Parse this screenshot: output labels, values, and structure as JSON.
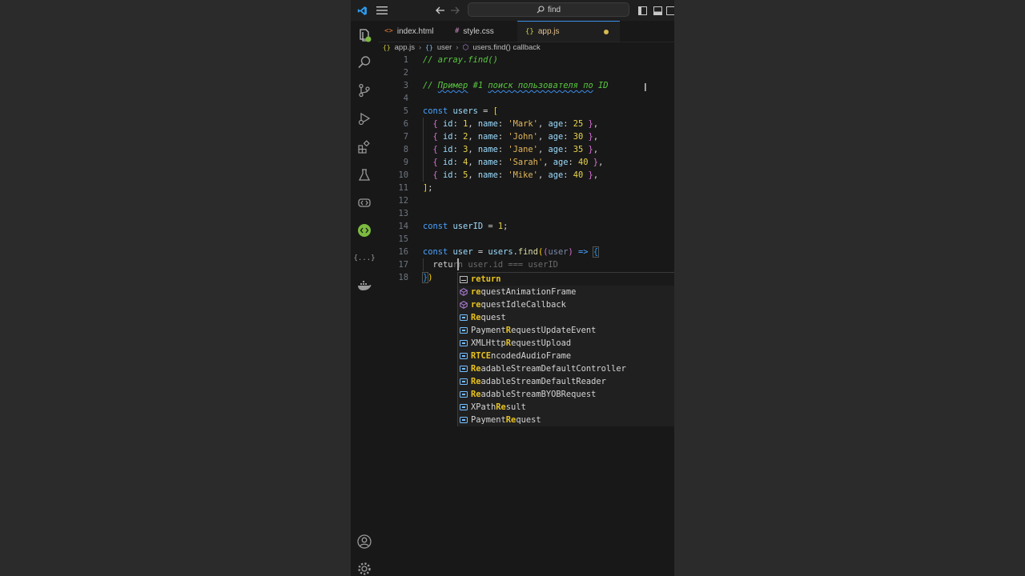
{
  "titlebar": {
    "search_text": "find"
  },
  "tabs": [
    {
      "label": "index.html",
      "icon": "<>"
    },
    {
      "label": "style.css",
      "icon": "#"
    },
    {
      "label": "app.js",
      "icon": "{}"
    }
  ],
  "breadcrumb": {
    "file": "app.js",
    "item1": "user",
    "item2": "users.find() callback"
  },
  "code": {
    "l1": "// array.find()",
    "l3_pre": "// ",
    "l3_word1": "Пример",
    "l3_mid": " #1 ",
    "l3_words": "поиск пользователя по",
    "l3_post": " ID",
    "users": [
      {
        "id": "1",
        "name": "'Mark'",
        "age": "25"
      },
      {
        "id": "2",
        "name": "'John'",
        "age": "30"
      },
      {
        "id": "3",
        "name": "'Jane'",
        "age": "35"
      },
      {
        "id": "4",
        "name": "'Sarah'",
        "age": "40"
      },
      {
        "id": "5",
        "name": "'Mike'",
        "age": "40"
      }
    ],
    "typed": "retu",
    "ghost": "rn user.id === userID"
  },
  "suggestions": [
    {
      "pre": "",
      "bold": "return",
      "post": ""
    },
    {
      "pre": "",
      "bold": "re",
      "post": "questAnimationFrame"
    },
    {
      "pre": "",
      "bold": "re",
      "post": "questIdleCallback"
    },
    {
      "pre": "",
      "bold": "Re",
      "post": "quest"
    },
    {
      "pre": "Payment",
      "bold": "R",
      "post": "equestUpdateEvent"
    },
    {
      "pre": "XMLHttp",
      "bold": "R",
      "post": "equestUpload"
    },
    {
      "pre": "",
      "bold": "RTCE",
      "post": "ncodedAudioFrame"
    },
    {
      "pre": "",
      "bold": "Re",
      "post": "adableStreamDefaultController"
    },
    {
      "pre": "",
      "bold": "Re",
      "post": "adableStreamDefaultReader"
    },
    {
      "pre": "",
      "bold": "Re",
      "post": "adableStreamBYOBRequest"
    },
    {
      "pre": "XPath",
      "bold": "Re",
      "post": "sult"
    },
    {
      "pre": "Payment",
      "bold": "Re",
      "post": "quest"
    }
  ],
  "icons": {
    "activity": [
      "explorer-icon",
      "search-icon",
      "source-control-icon",
      "run-debug-icon",
      "extensions-icon",
      "testing-icon",
      "remote-icon",
      "live-preview-icon",
      "json-icon",
      "docker-icon",
      "account-icon",
      "settings-gear-icon"
    ]
  }
}
